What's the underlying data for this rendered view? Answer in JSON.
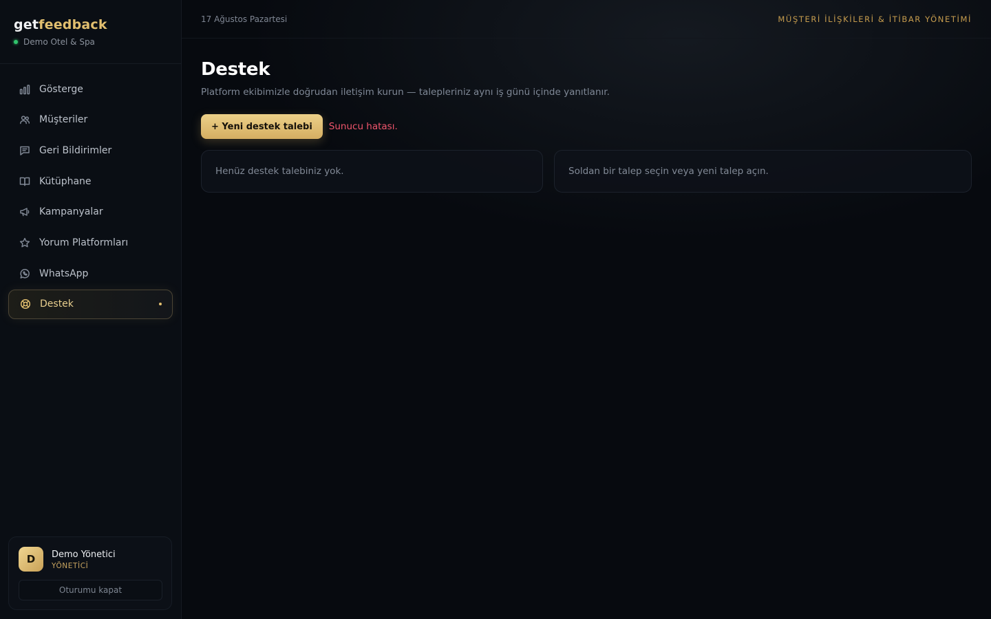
{
  "brand": {
    "logo_get": "get",
    "logo_feedback": "feedback",
    "property_name": "Demo Otel & Spa",
    "status_color": "#31c46d"
  },
  "sidebar": {
    "items": [
      {
        "label": "Gösterge",
        "icon": "bar-chart-icon"
      },
      {
        "label": "Müşteriler",
        "icon": "users-icon"
      },
      {
        "label": "Geri Bildirimler",
        "icon": "message-icon"
      },
      {
        "label": "Kütüphane",
        "icon": "book-icon"
      },
      {
        "label": "Kampanyalar",
        "icon": "megaphone-icon"
      },
      {
        "label": "Yorum Platformları",
        "icon": "star-icon"
      },
      {
        "label": "WhatsApp",
        "icon": "whatsapp-icon"
      },
      {
        "label": "Destek",
        "icon": "lifebuoy-icon",
        "active": true
      }
    ]
  },
  "user": {
    "initial": "D",
    "name": "Demo Yönetici",
    "role": "YÖNETİCİ",
    "logout_label": "Oturumu kapat"
  },
  "topbar": {
    "date": "17 Ağustos Pazartesi",
    "tagline": "MÜŞTERİ İLİŞKİLERİ & İTİBAR YÖNETİMİ"
  },
  "page": {
    "title": "Destek",
    "subtitle": "Platform ekibimizle doğrudan iletişim kurun — talepleriniz aynı iş günü içinde yanıtlanır.",
    "new_ticket_label": "+ Yeni destek talebi",
    "error_message": "Sunucu hatası.",
    "empty_list_text": "Henüz destek talebiniz yok.",
    "empty_detail_text": "Soldan bir talep seçin veya yeni talep açın."
  },
  "colors": {
    "accent": "#e2bf6f",
    "error": "#f0556c",
    "background": "#070a0f"
  }
}
